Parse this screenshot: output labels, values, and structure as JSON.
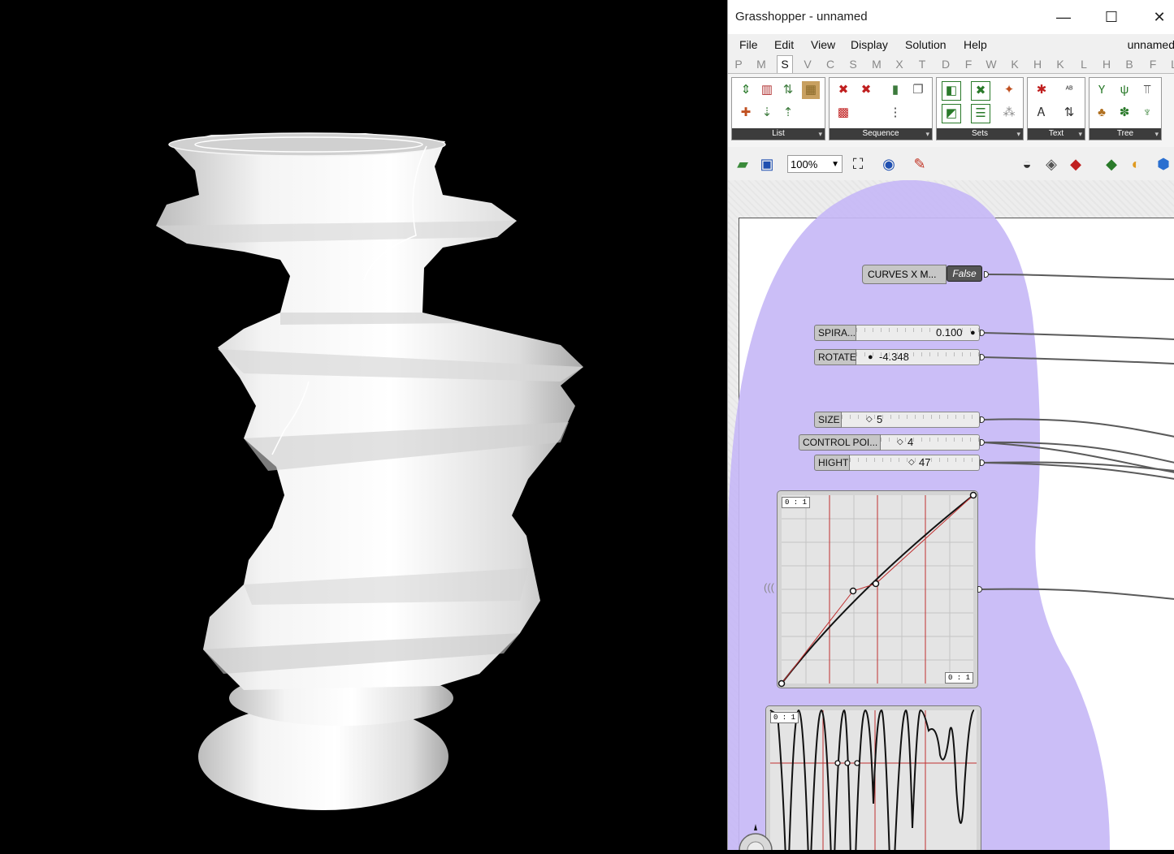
{
  "window": {
    "title": "Grasshopper - unnamed",
    "controls": {
      "minimize": "—",
      "maximize": "☐",
      "close": "✕"
    }
  },
  "menu": {
    "items": [
      "File",
      "Edit",
      "View",
      "Display",
      "Solution",
      "Help"
    ],
    "document": "unnamed"
  },
  "tabs": {
    "items": [
      "P",
      "M",
      "S",
      "V",
      "C",
      "S",
      "M",
      "X",
      "T",
      "D",
      "F",
      "W",
      "K",
      "H",
      "K",
      "L",
      "H",
      "B",
      "F",
      "L"
    ],
    "active_index": 2
  },
  "ribbon": {
    "panels": [
      "List",
      "Sequence",
      "Sets",
      "Text",
      "Tree"
    ]
  },
  "toolbar": {
    "zoom": "100%"
  },
  "canvas": {
    "toggle": {
      "label": "CURVES X M...",
      "value": "False"
    },
    "sliders": [
      {
        "label": "SPIRA...",
        "value": "0.100"
      },
      {
        "label": "ROTATE",
        "value": "-4.348"
      },
      {
        "label": "SIZE",
        "value": "5"
      },
      {
        "label": "CONTROL POI...",
        "value": "4"
      },
      {
        "label": "HIGHT",
        "value": "47"
      }
    ],
    "graph1": {
      "tag_top": "0 : 1",
      "tag_bottom": "0 : 1"
    },
    "graph2": {
      "tag_top": "0 : 1"
    }
  }
}
